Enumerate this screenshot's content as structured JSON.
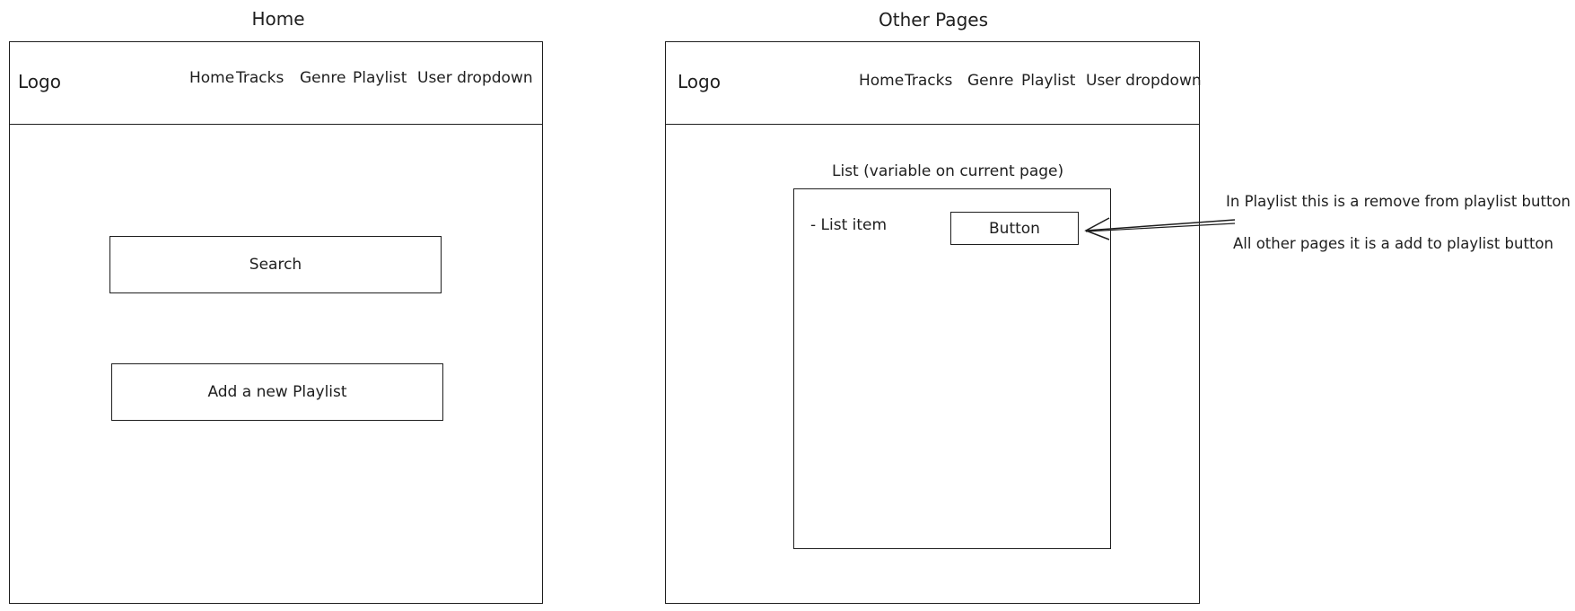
{
  "home": {
    "title": "Home",
    "logo": "Logo",
    "nav": [
      "Home",
      "Tracks",
      "Genre",
      "Playlist",
      "User dropdown"
    ],
    "search_label": "Search",
    "add_playlist_label": "Add a new Playlist"
  },
  "other": {
    "title": "Other Pages",
    "logo": "Logo",
    "nav": [
      "Home",
      "Tracks",
      "Genre",
      "Playlist",
      "User dropdown"
    ],
    "list_title": "List (variable on current page)",
    "list_item": "- List item",
    "button_label": "Button"
  },
  "annotation": {
    "line1": "In Playlist this is a remove from playlist button",
    "line2": "All other pages it is a add to playlist button"
  }
}
